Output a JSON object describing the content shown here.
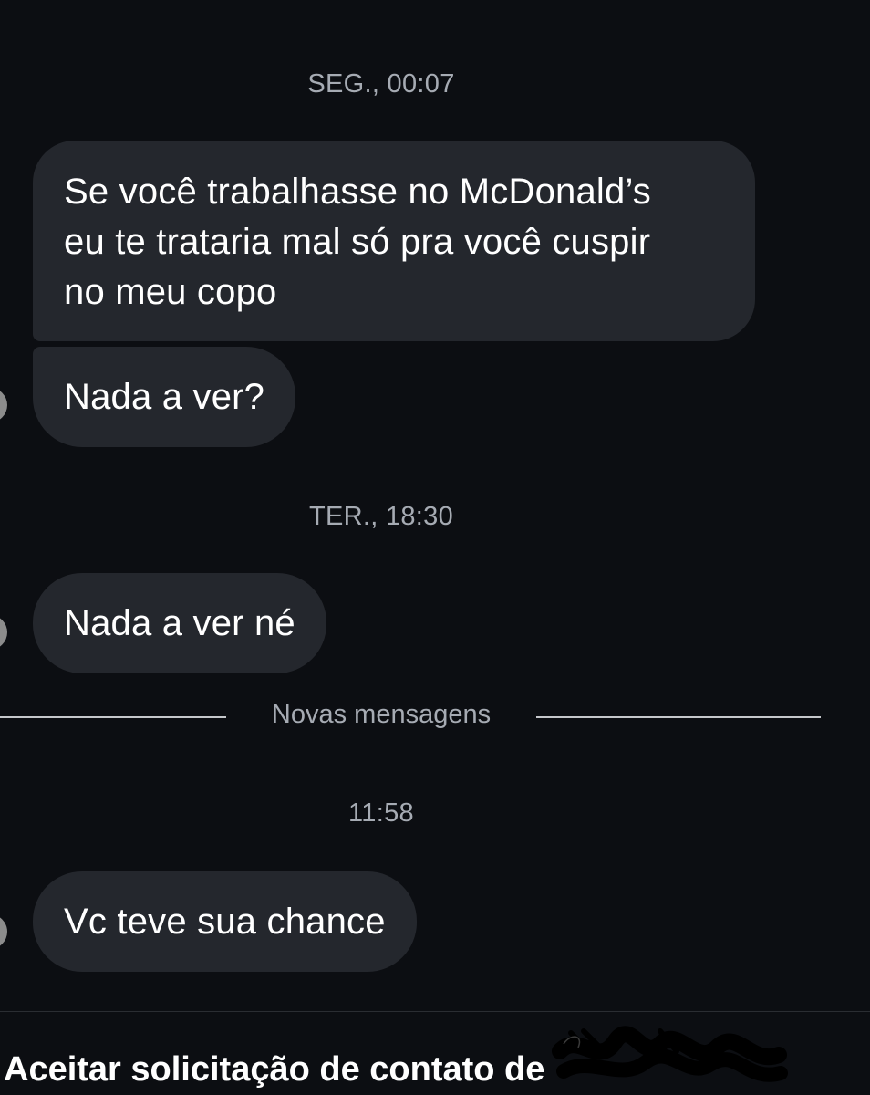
{
  "conversation": {
    "timestamps": {
      "first": "SEG., 00:07",
      "second": "TER., 18:30",
      "third": "11:58"
    },
    "messages": [
      {
        "text": "Se você trabalhasse no McDonald’s\neu te trataria mal só pra você cuspir\nno meu copo"
      },
      {
        "text": "Nada a ver?"
      },
      {
        "text": "Nada a ver né"
      },
      {
        "text": "Vc teve sua chance"
      }
    ],
    "new_messages_divider": "Novas mensagens"
  },
  "footer": {
    "accept_request": "Aceitar solicitação de contato de"
  },
  "colors": {
    "background": "#0c0e12",
    "bubble": "#24272d",
    "meta_text": "#a6abb3",
    "text": "#ffffff"
  }
}
